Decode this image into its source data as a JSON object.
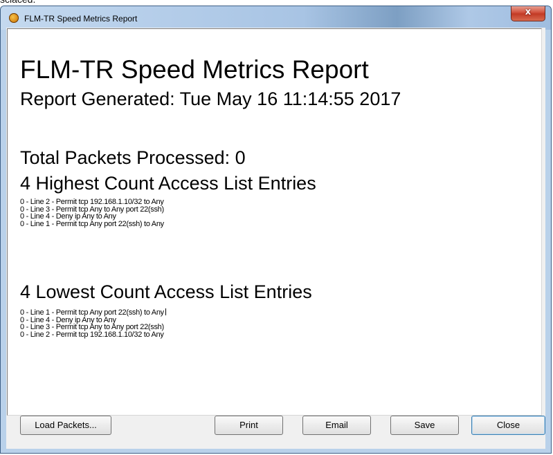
{
  "window": {
    "title": "FLM-TR Speed Metrics Report",
    "close_glyph": "x"
  },
  "report": {
    "heading": "FLM-TR Speed Metrics Report",
    "generated": "Report Generated: Tue May 16 11:14:55 2017",
    "total_packets": "Total Packets Processed: 0",
    "highest": {
      "title": "4 Highest Count Access List Entries",
      "entries": [
        "0 - Line 2 - Permit tcp 192.168.1.10/32 to Any",
        "0 - Line 3 - Permit tcp Any to Any port 22(ssh)",
        "0 - Line 4 - Deny ip Any to Any",
        "0 - Line 1 - Permit tcp Any port 22(ssh) to Any"
      ]
    },
    "lowest": {
      "title": "4 Lowest Count Access List Entries",
      "entries": [
        "0 - Line 1 - Permit tcp Any port 22(ssh) to Any",
        "0 - Line 4 - Deny ip Any to Any",
        "0 - Line 3 - Permit tcp Any to Any port 22(ssh)",
        "0 - Line 2 - Permit tcp 192.168.1.10/32 to Any"
      ]
    }
  },
  "buttons": {
    "load": "Load Packets...",
    "print": "Print",
    "email": "Email",
    "save": "Save",
    "close": "Close"
  }
}
